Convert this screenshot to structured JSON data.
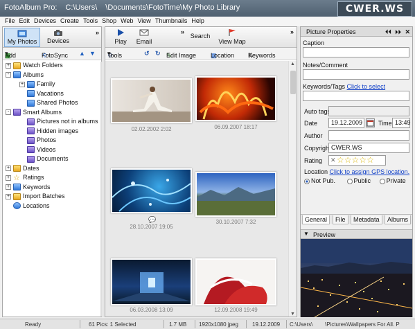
{
  "window": {
    "app": "FotoAlbum Pro:",
    "path1": "C:\\Users\\",
    "path2": "\\Documents\\FotoTime\\My Photo Library",
    "watermark": "CWER.WS"
  },
  "menu": [
    "File",
    "Edit",
    "Devices",
    "Create",
    "Tools",
    "Shop",
    "Web",
    "View",
    "Thumbnails",
    "Help"
  ],
  "left_panel": {
    "tabs": [
      {
        "label": "My Photos",
        "icon": "photos-icon"
      },
      {
        "label": "Devices",
        "icon": "camera-icon"
      }
    ],
    "add_label": "Add",
    "fotosync_label": "FotoSync",
    "tree": [
      {
        "label": "Watch Folders",
        "level": 0,
        "expander": "+",
        "icon": "folder-icon"
      },
      {
        "label": "Albums",
        "level": 0,
        "expander": "-",
        "icon": "album-icon"
      },
      {
        "label": "Family",
        "level": 1,
        "expander": "+",
        "icon": "album-icon"
      },
      {
        "label": "Vacations",
        "level": 1,
        "expander": "",
        "icon": "album-icon"
      },
      {
        "label": "Shared Photos",
        "level": 1,
        "expander": "",
        "icon": "album-icon"
      },
      {
        "label": "Smart Albums",
        "level": 0,
        "expander": "-",
        "icon": "smart-album-icon"
      },
      {
        "label": "Pictures not in albums",
        "level": 1,
        "expander": "",
        "icon": "smart-album-icon"
      },
      {
        "label": "Hidden images",
        "level": 1,
        "expander": "",
        "icon": "smart-album-icon"
      },
      {
        "label": "Photos",
        "level": 1,
        "expander": "",
        "icon": "smart-album-icon"
      },
      {
        "label": "Videos",
        "level": 1,
        "expander": "",
        "icon": "smart-album-icon"
      },
      {
        "label": "Documents",
        "level": 1,
        "expander": "",
        "icon": "smart-album-icon"
      },
      {
        "label": "Dates",
        "level": 0,
        "expander": "+",
        "icon": "folder-icon"
      },
      {
        "label": "Ratings",
        "level": 0,
        "expander": "+",
        "icon": "star-icon"
      },
      {
        "label": "Keywords",
        "level": 0,
        "expander": "+",
        "icon": "keyword-icon"
      },
      {
        "label": "Import Batches",
        "level": 0,
        "expander": "+",
        "icon": "folder-icon"
      },
      {
        "label": "Locations",
        "level": 0,
        "expander": "",
        "icon": "location-icon"
      }
    ]
  },
  "toolbar": {
    "play": "Play",
    "email": "Email",
    "search": "Search",
    "view_map": "View Map",
    "tools": "Tools",
    "edit_image": "Edit Image",
    "location": "Location",
    "keywords": "Keywords"
  },
  "thumbnails": [
    {
      "caption": "02.02.2002  2:02",
      "scene": "yoga",
      "has_comment": false
    },
    {
      "caption": "06.09.2007  18:17",
      "scene": "flames",
      "has_comment": false
    },
    {
      "caption": "28.10.2007  19:05",
      "scene": "blue-swirl",
      "has_comment": true
    },
    {
      "caption": "30.10.2007  7:32",
      "scene": "landscape",
      "has_comment": false
    },
    {
      "caption": "06.03.2008  13:09",
      "scene": "blue-room",
      "has_comment": false
    },
    {
      "caption": "12.09.2008  19:49",
      "scene": "red-splash",
      "has_comment": false
    }
  ],
  "properties": {
    "header": "Picture Properties",
    "caption_label": "Caption",
    "caption_value": "",
    "notes_label": "Notes/Comment",
    "notes_value": "",
    "keywords_label": "Keywords/Tags",
    "keywords_link": "Click to select",
    "keywords_value": "",
    "autotags_label": "Auto tags",
    "date_label": "Date",
    "date_value": "19.12.2009",
    "time_label": "Time",
    "time_value": "13:49",
    "author_label": "Author",
    "author_value": "",
    "copyright_label": "Copyright",
    "copyright_value": "CWER.WS",
    "rating_label": "Rating",
    "rating_value": 0,
    "rating_max": 5,
    "location_label": "Location",
    "location_link": "Click to assign GPS location.",
    "privacy_options": [
      "Not Pub.",
      "Public",
      "Private"
    ],
    "privacy_selected": "Not Pub.",
    "tabs": [
      "General",
      "File",
      "Metadata",
      "Albums"
    ],
    "active_tab": "General",
    "preview_label": "Preview"
  },
  "status": {
    "state": "Ready",
    "count": "61 Pics: 1 Selected",
    "size": "1.7 MB",
    "dims": "1920x1080 jpeg",
    "date": "19.12.2009",
    "path1": "C:\\Users\\",
    "path2": "\\Pictures\\Wallpapers For All. P"
  }
}
